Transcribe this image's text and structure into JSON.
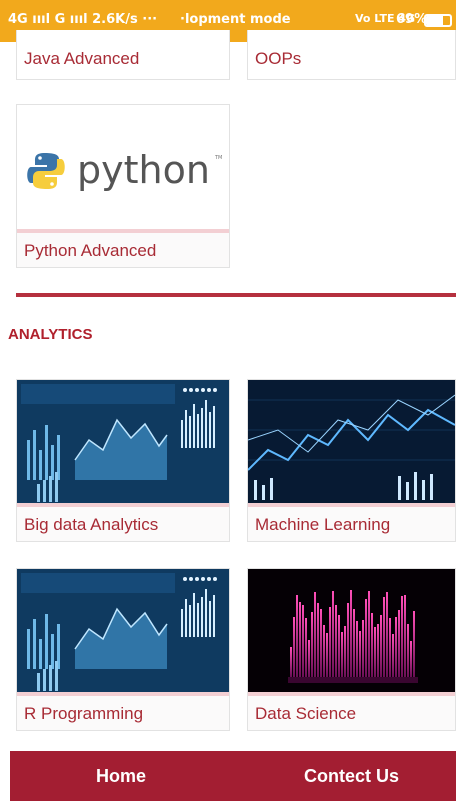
{
  "status_bar": {
    "network": "4G ıııl G ıııl 2.6K/s ···",
    "mode": "·lopment mode",
    "volte": "Vo LTE 4G",
    "battery_text": "69%",
    "battery_level": 0.69
  },
  "courses_top": [
    {
      "label": "Java Advanced"
    },
    {
      "label": "OOPs"
    }
  ],
  "python_card": {
    "logo_text": "python",
    "tm": "TM",
    "label": "Python Advanced"
  },
  "section": {
    "title": "ANALYTICS"
  },
  "analytics_courses": [
    {
      "label": "Big data Analytics",
      "icon": "dashboard-chart-image"
    },
    {
      "label": "Machine Learning",
      "icon": "ml-graph-image"
    },
    {
      "label": "R Programming",
      "icon": "dashboard-chart-image"
    },
    {
      "label": "Data Science",
      "icon": "data-waves-image"
    }
  ],
  "bottom_nav": {
    "home": "Home",
    "contact": "Contect Us"
  },
  "colors": {
    "status_bar": "#f2a91c",
    "accent": "#a31e32",
    "label_text": "#a82b35"
  }
}
